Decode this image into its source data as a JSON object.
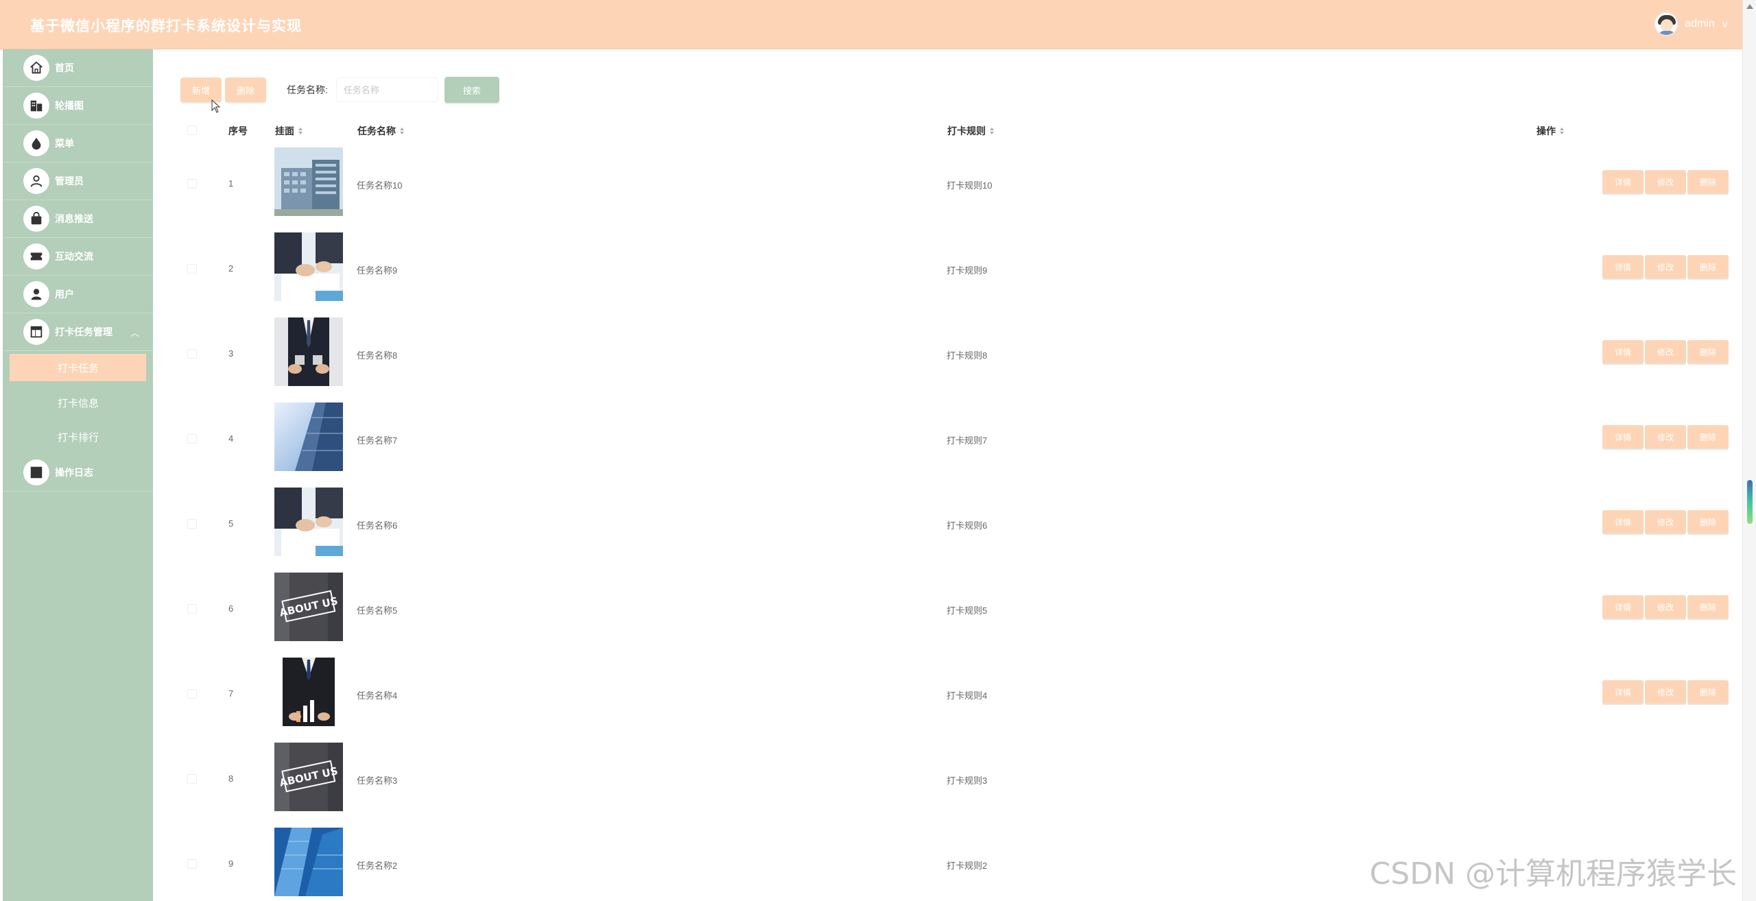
{
  "header": {
    "title": "基于微信小程序的群打卡系统设计与实现",
    "username": "admin",
    "user_chevron": "∨"
  },
  "sidebar": {
    "items": [
      {
        "label": "首页",
        "icon": "home-icon"
      },
      {
        "label": "轮播图",
        "icon": "building-icon"
      },
      {
        "label": "菜单",
        "icon": "drop-icon"
      },
      {
        "label": "管理员",
        "icon": "person-outline-icon"
      },
      {
        "label": "消息推送",
        "icon": "bag-icon"
      },
      {
        "label": "互动交流",
        "icon": "ticket-icon"
      },
      {
        "label": "用户",
        "icon": "person-icon"
      },
      {
        "label": "打卡任务管理",
        "icon": "layout-icon",
        "expanded": true,
        "children": [
          {
            "label": "打卡任务",
            "active": true
          },
          {
            "label": "打卡信息",
            "active": false
          },
          {
            "label": "打卡排行",
            "active": false
          }
        ]
      },
      {
        "label": "操作日志",
        "icon": "square-icon"
      }
    ],
    "collapse_glyph": "︿"
  },
  "toolbar": {
    "add_label": "新增",
    "delete_label": "删除",
    "search_label": "任务名称:",
    "search_placeholder": "任务名称",
    "search_button": "搜索"
  },
  "table": {
    "columns": {
      "index": "序号",
      "cover": "挂面",
      "name": "任务名称",
      "rule": "打卡规则",
      "ops": "操作"
    },
    "op_labels": {
      "detail": "详情",
      "edit": "修改",
      "delete": "删除"
    },
    "rows": [
      {
        "index": "1",
        "name": "任务名称10",
        "rule": "打卡规则10",
        "image": "office-building",
        "show_ops": true
      },
      {
        "index": "2",
        "name": "任务名称9",
        "rule": "打卡规则9",
        "image": "hands-document",
        "show_ops": true
      },
      {
        "index": "3",
        "name": "任务名称8",
        "rule": "打卡规则8",
        "image": "businessman-suit",
        "show_ops": true
      },
      {
        "index": "4",
        "name": "任务名称7",
        "rule": "打卡规则7",
        "image": "glass-tower",
        "show_ops": true
      },
      {
        "index": "5",
        "name": "任务名称6",
        "rule": "打卡规则6",
        "image": "hands-document",
        "show_ops": true
      },
      {
        "index": "6",
        "name": "任务名称5",
        "rule": "打卡规则5",
        "image": "about-us-sign",
        "show_ops": true
      },
      {
        "index": "7",
        "name": "任务名称4",
        "rule": "打卡规则4",
        "image": "businessman-chart",
        "show_ops": true
      },
      {
        "index": "8",
        "name": "任务名称3",
        "rule": "打卡规则3",
        "image": "about-us-sign",
        "show_ops": false
      },
      {
        "index": "9",
        "name": "任务名称2",
        "rule": "打卡规则2",
        "image": "blue-skyscrapers",
        "show_ops": false
      }
    ]
  },
  "colors": {
    "header_bg": "#fdd5b6",
    "sidebar_bg": "#b3ceb9",
    "accent_peach": "#fdd5b6",
    "accent_green": "#b3ceb9"
  },
  "watermark": "CSDN @计算机程序猿学长"
}
